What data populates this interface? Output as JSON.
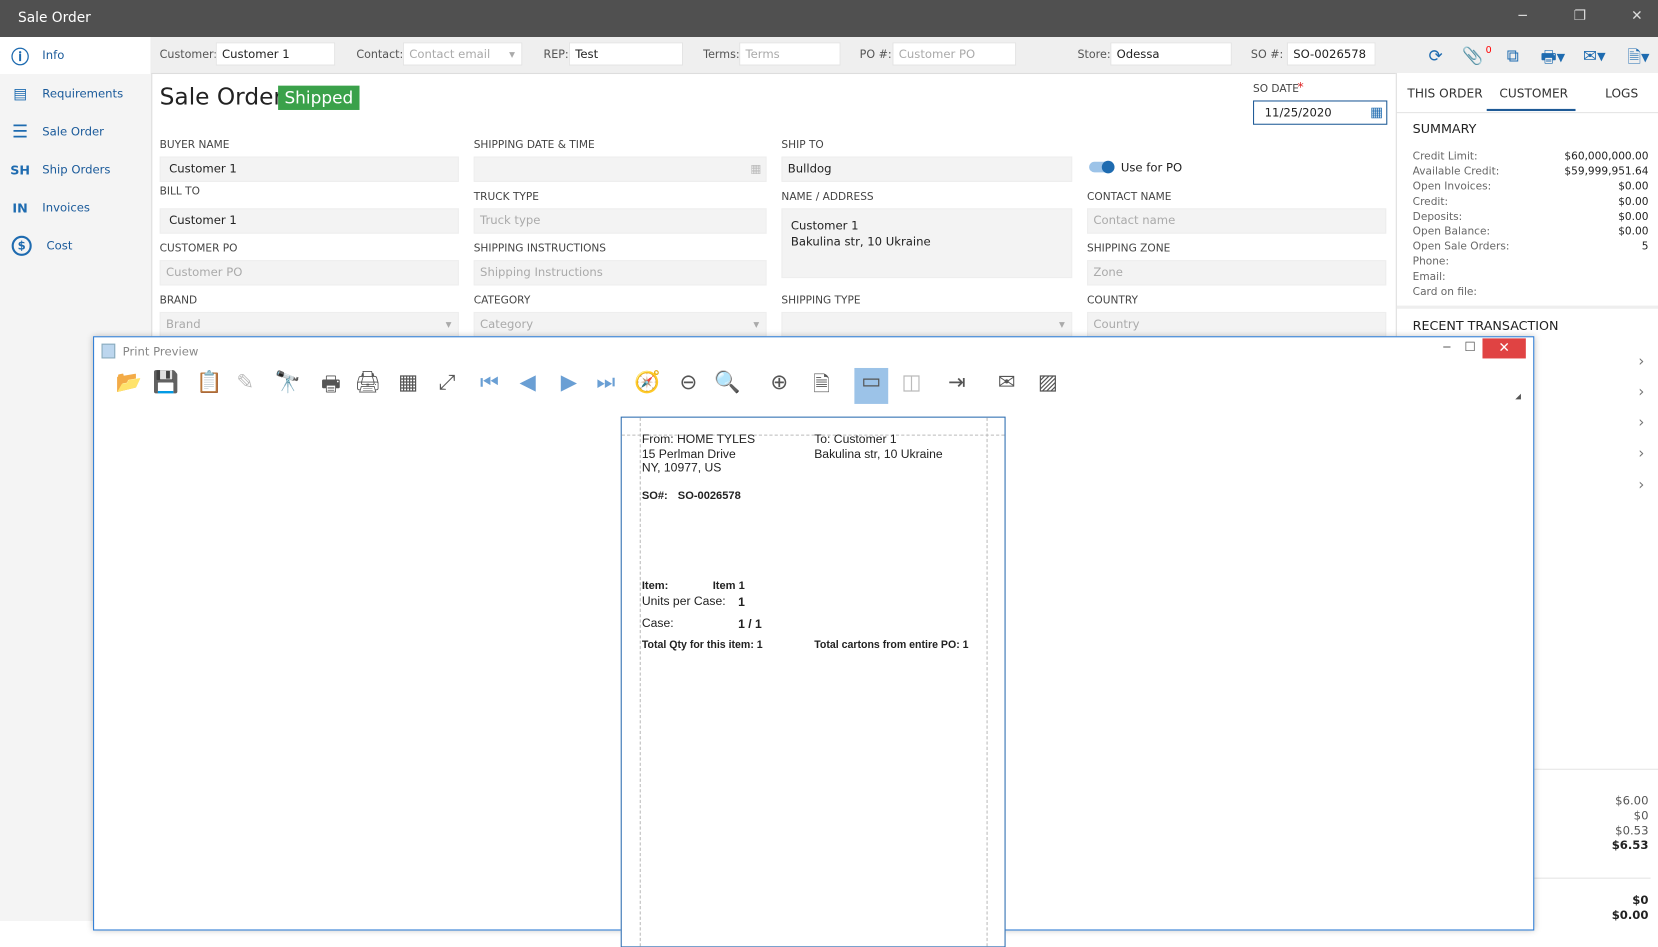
{
  "window": {
    "title": "Sale Order",
    "minimize_icon": "minimize-icon",
    "restore_icon": "restore-icon",
    "close_icon": "close-icon"
  },
  "sidebar": {
    "items": [
      {
        "label": "Info",
        "icon": "info-icon",
        "glyph": "ⓘ"
      },
      {
        "label": "Requirements",
        "icon": "clipboard-icon",
        "glyph": "📋"
      },
      {
        "label": "Sale Order",
        "icon": "list-icon",
        "glyph": "☰"
      },
      {
        "label": "Ship Orders",
        "icon": "sh-icon",
        "glyph": "SH"
      },
      {
        "label": "Invoices",
        "icon": "in-icon",
        "glyph": "IN"
      },
      {
        "label": "Cost",
        "icon": "dollar-icon",
        "glyph": "$"
      }
    ]
  },
  "fieldbar": {
    "customer_label": "Customer:",
    "customer_value": "Customer 1",
    "contact_label": "Contact:",
    "contact_placeholder": "Contact email",
    "rep_label": "REP:",
    "rep_value": "Test",
    "terms_label": "Terms:",
    "terms_placeholder": "Terms",
    "po_label": "PO #:",
    "po_placeholder": "Customer PO",
    "store_label": "Store:",
    "store_value": "Odessa",
    "so_label": "SO #:",
    "so_value": "SO-0026578",
    "attachment_count": "0"
  },
  "header": {
    "title": "Sale Order",
    "status": "Shipped",
    "status_color": "#3aa14a",
    "so_date_label": "SO DATE",
    "required_mark": "*",
    "so_date": "11/25/2020"
  },
  "form": {
    "buyer_name_label": "BUYER NAME",
    "buyer_name": "Customer 1",
    "bill_to_label": "BILL TO",
    "bill_to": "Customer 1",
    "customer_po_label": "CUSTOMER PO",
    "customer_po_placeholder": "Customer PO",
    "brand_label": "BRAND",
    "brand_placeholder": "Brand",
    "shipping_date_label": "SHIPPING DATE & TIME",
    "truck_type_label": "TRUCK TYPE",
    "truck_type_placeholder": "Truck type",
    "shipping_instructions_label": "SHIPPING INSTRUCTIONS",
    "shipping_instructions_placeholder": "Shipping Instructions",
    "category_label": "CATEGORY",
    "category_placeholder": "Category",
    "ship_to_label": "SHIP TO",
    "ship_to": "Bulldog",
    "use_for_po_label": "Use for PO",
    "name_address_label": "NAME / ADDRESS",
    "name_address_line1": "Customer 1",
    "name_address_line2": "Bakulina str, 10 Ukraine",
    "shipping_type_label": "SHIPPING TYPE",
    "contact_name_label": "CONTACT NAME",
    "contact_name_placeholder": "Contact name",
    "shipping_zone_label": "SHIPPING ZONE",
    "shipping_zone_placeholder": "Zone",
    "country_label": "COUNTRY",
    "country_placeholder": "Country"
  },
  "right_panel": {
    "tabs": [
      "THIS ORDER",
      "CUSTOMER",
      "LOGS"
    ],
    "active_tab": "CUSTOMER",
    "summary_title": "SUMMARY",
    "summary": [
      {
        "label": "Credit Limit:",
        "value": "$60,000,000.00"
      },
      {
        "label": "Available Credit:",
        "value": "$59,999,951.64"
      },
      {
        "label": "Open Invoices:",
        "value": "$0.00"
      },
      {
        "label": "Credit:",
        "value": "$0.00"
      },
      {
        "label": "Deposits:",
        "value": "$0.00"
      },
      {
        "label": "Open Balance:",
        "value": "$0.00"
      },
      {
        "label": "Open Sale Orders:",
        "value": "5"
      },
      {
        "label": "Phone:",
        "value": ""
      },
      {
        "label": "Email:",
        "value": ""
      },
      {
        "label": "Card on file:",
        "value": ""
      }
    ],
    "recent_title": "RECENT TRANSACTION",
    "amounts": [
      "$6.00",
      "$0",
      "$0.53",
      "$6.53"
    ],
    "amounts2": [
      "$0",
      "$0.00"
    ]
  },
  "print_preview": {
    "title": "Print Preview",
    "toolbar": [
      "folder-open-icon",
      "save-icon",
      "paste-icon",
      "edit-icon",
      "find-icon",
      "print-icon",
      "quick-print-icon",
      "page-setup-icon",
      "fit-icon",
      "first-page-icon",
      "prev-page-icon",
      "next-page-icon",
      "last-page-icon",
      "navigate-icon",
      "zoom-out-icon",
      "zoom-icon",
      "zoom-in-icon",
      "page-view-icon",
      "single-page-icon",
      "multi-page-icon",
      "export-icon",
      "email-icon",
      "watermark-icon"
    ],
    "page": {
      "from_line1": "From: HOME TYLES",
      "from_line2": "15 Perlman Drive",
      "from_line3": "NY, 10977, US",
      "to_line1": "To: Customer 1",
      "to_line2": "Bakulina str, 10 Ukraine",
      "so_label": "SO#:",
      "so_value": "SO-0026578",
      "item_label": "Item:",
      "item_value": "Item 1",
      "units_label": "Units per Case:",
      "units_value": "1",
      "case_label": "Case:",
      "case_value": "1 / 1",
      "total_qty": "Total Qty for this item: 1",
      "total_cartons": "Total cartons from entire PO: 1"
    }
  }
}
